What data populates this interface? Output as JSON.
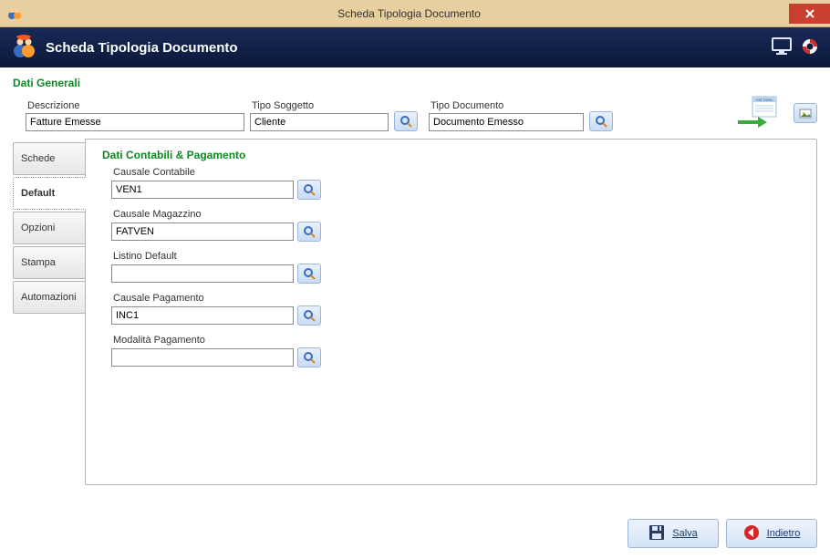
{
  "window": {
    "title": "Scheda Tipologia Documento"
  },
  "header": {
    "title": "Scheda Tipologia Documento"
  },
  "sections": {
    "generali_title": "Dati Generali",
    "contabili_title": "Dati Contabili & Pagamento"
  },
  "generali": {
    "descrizione_label": "Descrizione",
    "descrizione_value": "Fatture Emesse",
    "tipo_soggetto_label": "Tipo Soggetto",
    "tipo_soggetto_value": "Cliente",
    "tipo_documento_label": "Tipo Documento",
    "tipo_documento_value": "Documento Emesso"
  },
  "tabs": {
    "schede": "Schede",
    "default": "Default",
    "opzioni": "Opzioni",
    "stampa": "Stampa",
    "automazioni": "Automazioni"
  },
  "default_panel": {
    "causale_contabile_label": "Causale Contabile",
    "causale_contabile_value": "VEN1",
    "causale_magazzino_label": "Causale Magazzino",
    "causale_magazzino_value": "FATVEN",
    "listino_default_label": "Listino Default",
    "listino_default_value": "",
    "causale_pagamento_label": "Causale Pagamento",
    "causale_pagamento_value": "INC1",
    "modalita_pagamento_label": "Modalità Pagamento",
    "modalita_pagamento_value": ""
  },
  "footer": {
    "salva": "Salva",
    "indietro": "Indietro"
  }
}
